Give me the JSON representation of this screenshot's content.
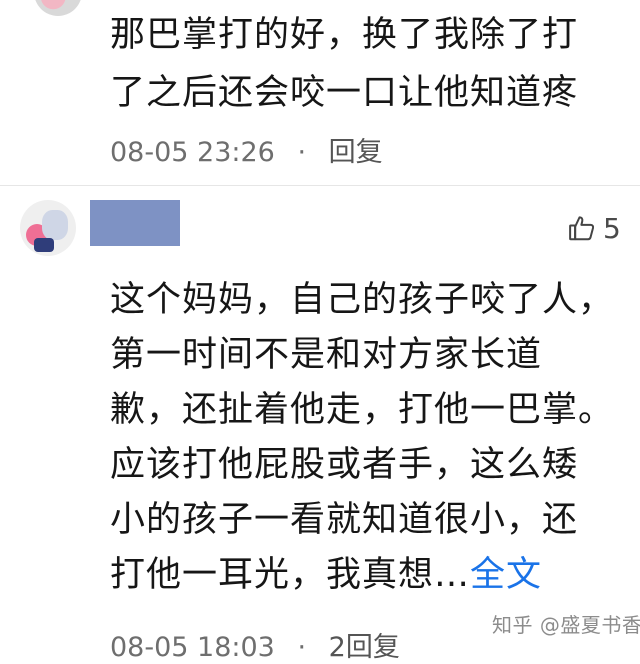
{
  "comment1": {
    "text_lines": [
      "那巴掌打的好，换了我除了打",
      "了之后还会咬一口让他知道疼"
    ],
    "time": "08-05 23:26",
    "separator": "·",
    "reply_label": "回复"
  },
  "comment2": {
    "like_count": "5",
    "text_lines": [
      "这个妈妈，自己的孩子咬了人，",
      "第一时间不是和对方家长道",
      "歉，还扯着他走，打他一巴掌。",
      "应该打他屁股或者手，这么矮",
      "小的孩子一看就知道很小，还",
      "打他一耳光，我真想…"
    ],
    "full_text_link": "全文",
    "time": "08-05 18:03",
    "separator": "·",
    "reply_label": "2回复"
  },
  "watermark": "知乎 @盛夏书香",
  "colors": {
    "link": "#1a73e8",
    "meta": "#6e6e6e",
    "username_redaction": "#7e92c4"
  },
  "icons": {
    "like": "thumbs-up-icon"
  }
}
